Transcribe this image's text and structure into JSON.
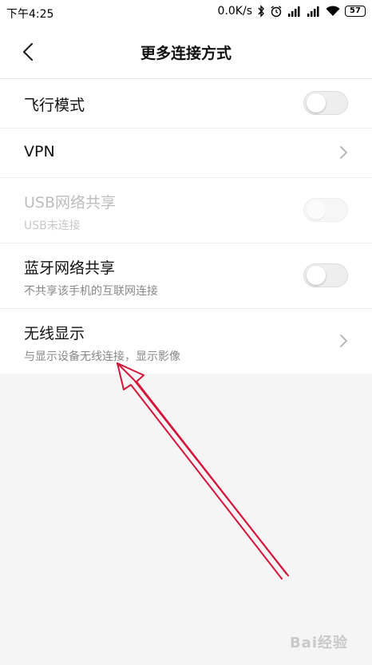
{
  "status_bar": {
    "time": "下午4:25",
    "network_speed": "0.0K/s",
    "battery_level": "57",
    "icons": [
      "bluetooth-icon",
      "alarm-icon",
      "signal-icon",
      "signal-icon",
      "wifi-icon",
      "battery-icon"
    ]
  },
  "header": {
    "back_icon": "chevron-left-icon",
    "title": "更多连接方式"
  },
  "settings": [
    {
      "title": "飞行模式",
      "type": "toggle",
      "on": false,
      "enabled": true
    },
    {
      "title": "VPN",
      "type": "link",
      "enabled": true
    },
    {
      "title": "USB网络共享",
      "subtitle": "USB未连接",
      "type": "toggle",
      "on": false,
      "enabled": false
    },
    {
      "title": "蓝牙网络共享",
      "subtitle": "不共享该手机的互联网连接",
      "type": "toggle",
      "on": false,
      "enabled": true
    },
    {
      "title": "无线显示",
      "subtitle": "与显示设备无线连接，显示影像",
      "type": "link",
      "enabled": true
    }
  ],
  "annotation": {
    "color": "#d6143a"
  },
  "colors": {
    "background": "#f5f5f5",
    "card": "#ffffff",
    "disabled_text": "#bdbdbd",
    "secondary_text": "#888888"
  },
  "watermark": {
    "text": "Bai经验"
  }
}
